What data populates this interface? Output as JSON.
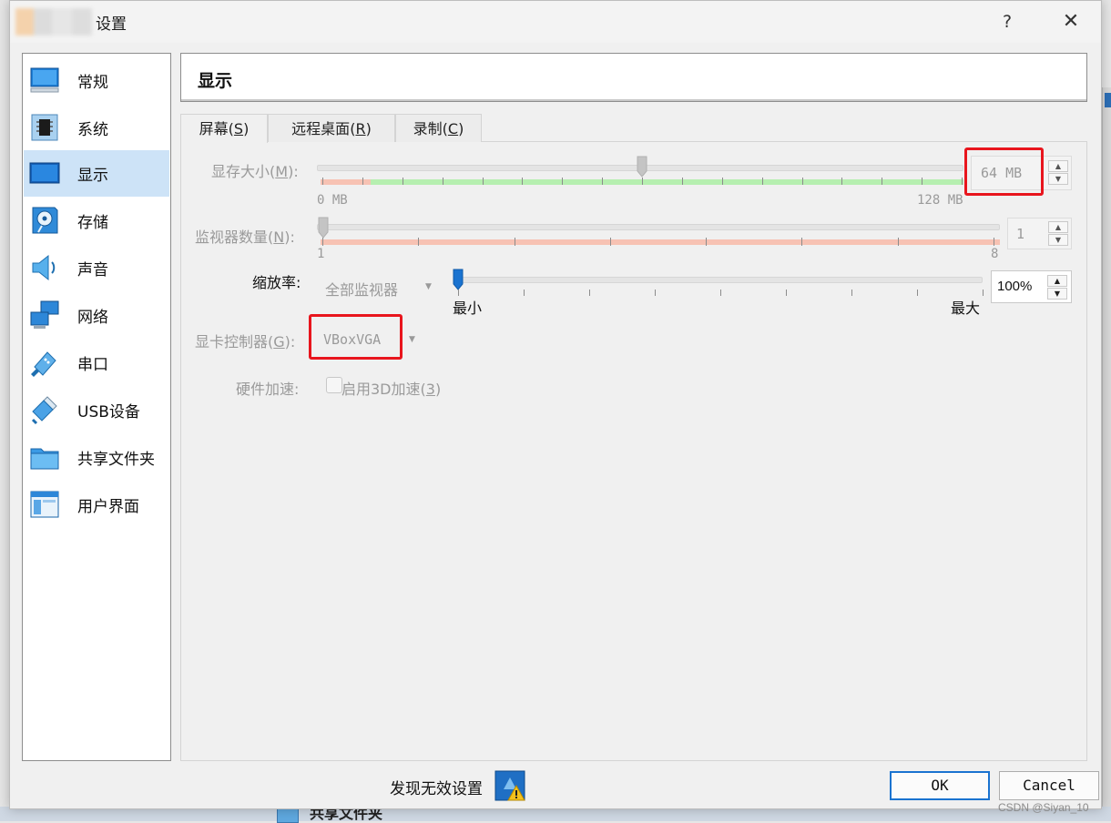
{
  "dialog": {
    "title": "设置",
    "help": "?",
    "close": "✕"
  },
  "sidebar": {
    "items": [
      {
        "label": "常规",
        "icon": "monitor-icon"
      },
      {
        "label": "系统",
        "icon": "chip-icon"
      },
      {
        "label": "显示",
        "icon": "display-icon",
        "selected": true
      },
      {
        "label": "存储",
        "icon": "disk-icon"
      },
      {
        "label": "声音",
        "icon": "speaker-icon"
      },
      {
        "label": "网络",
        "icon": "network-icon"
      },
      {
        "label": "串口",
        "icon": "serial-port-icon"
      },
      {
        "label": "USB设备",
        "icon": "usb-icon"
      },
      {
        "label": "共享文件夹",
        "icon": "folder-icon"
      },
      {
        "label": "用户界面",
        "icon": "window-icon"
      }
    ]
  },
  "header": {
    "title": "显示"
  },
  "tabs": [
    {
      "label": "屏幕",
      "key": "S",
      "active": true
    },
    {
      "label": "远程桌面",
      "key": "R"
    },
    {
      "label": "录制",
      "key": "C"
    }
  ],
  "screen": {
    "video_memory": {
      "label": "显存大小",
      "key": "M",
      "value": "64 MB",
      "min_label": "0 MB",
      "max_label": "128 MB",
      "position": 0.5
    },
    "monitor_count": {
      "label": "监视器数量",
      "key": "N",
      "value": "1",
      "min_label": "1",
      "max_label": "8",
      "position": 0
    },
    "scale": {
      "label": "缩放率:",
      "monitor_select": "全部监视器",
      "value": "100%",
      "min_label": "最小",
      "max_label": "最大",
      "position": 0
    },
    "graphics_controller": {
      "label": "显卡控制器",
      "key": "G",
      "value": "VBoxVGA"
    },
    "acceleration": {
      "label": "硬件加速:",
      "checkbox_label": "启用3D加速",
      "key": "3",
      "checked": false
    }
  },
  "footer": {
    "warning": "发现无效设置",
    "ok": "OK",
    "cancel": "Cancel"
  },
  "background": {
    "tree_label": "共享文件夹",
    "watermark": "CSDN @Siyan_10"
  },
  "colors": {
    "selection": "#cde3f7",
    "highlight_box": "#e8151d",
    "slider_handle": "#1a73d0",
    "green_range": "#b6efb0",
    "red_range": "#f7c2b3"
  }
}
